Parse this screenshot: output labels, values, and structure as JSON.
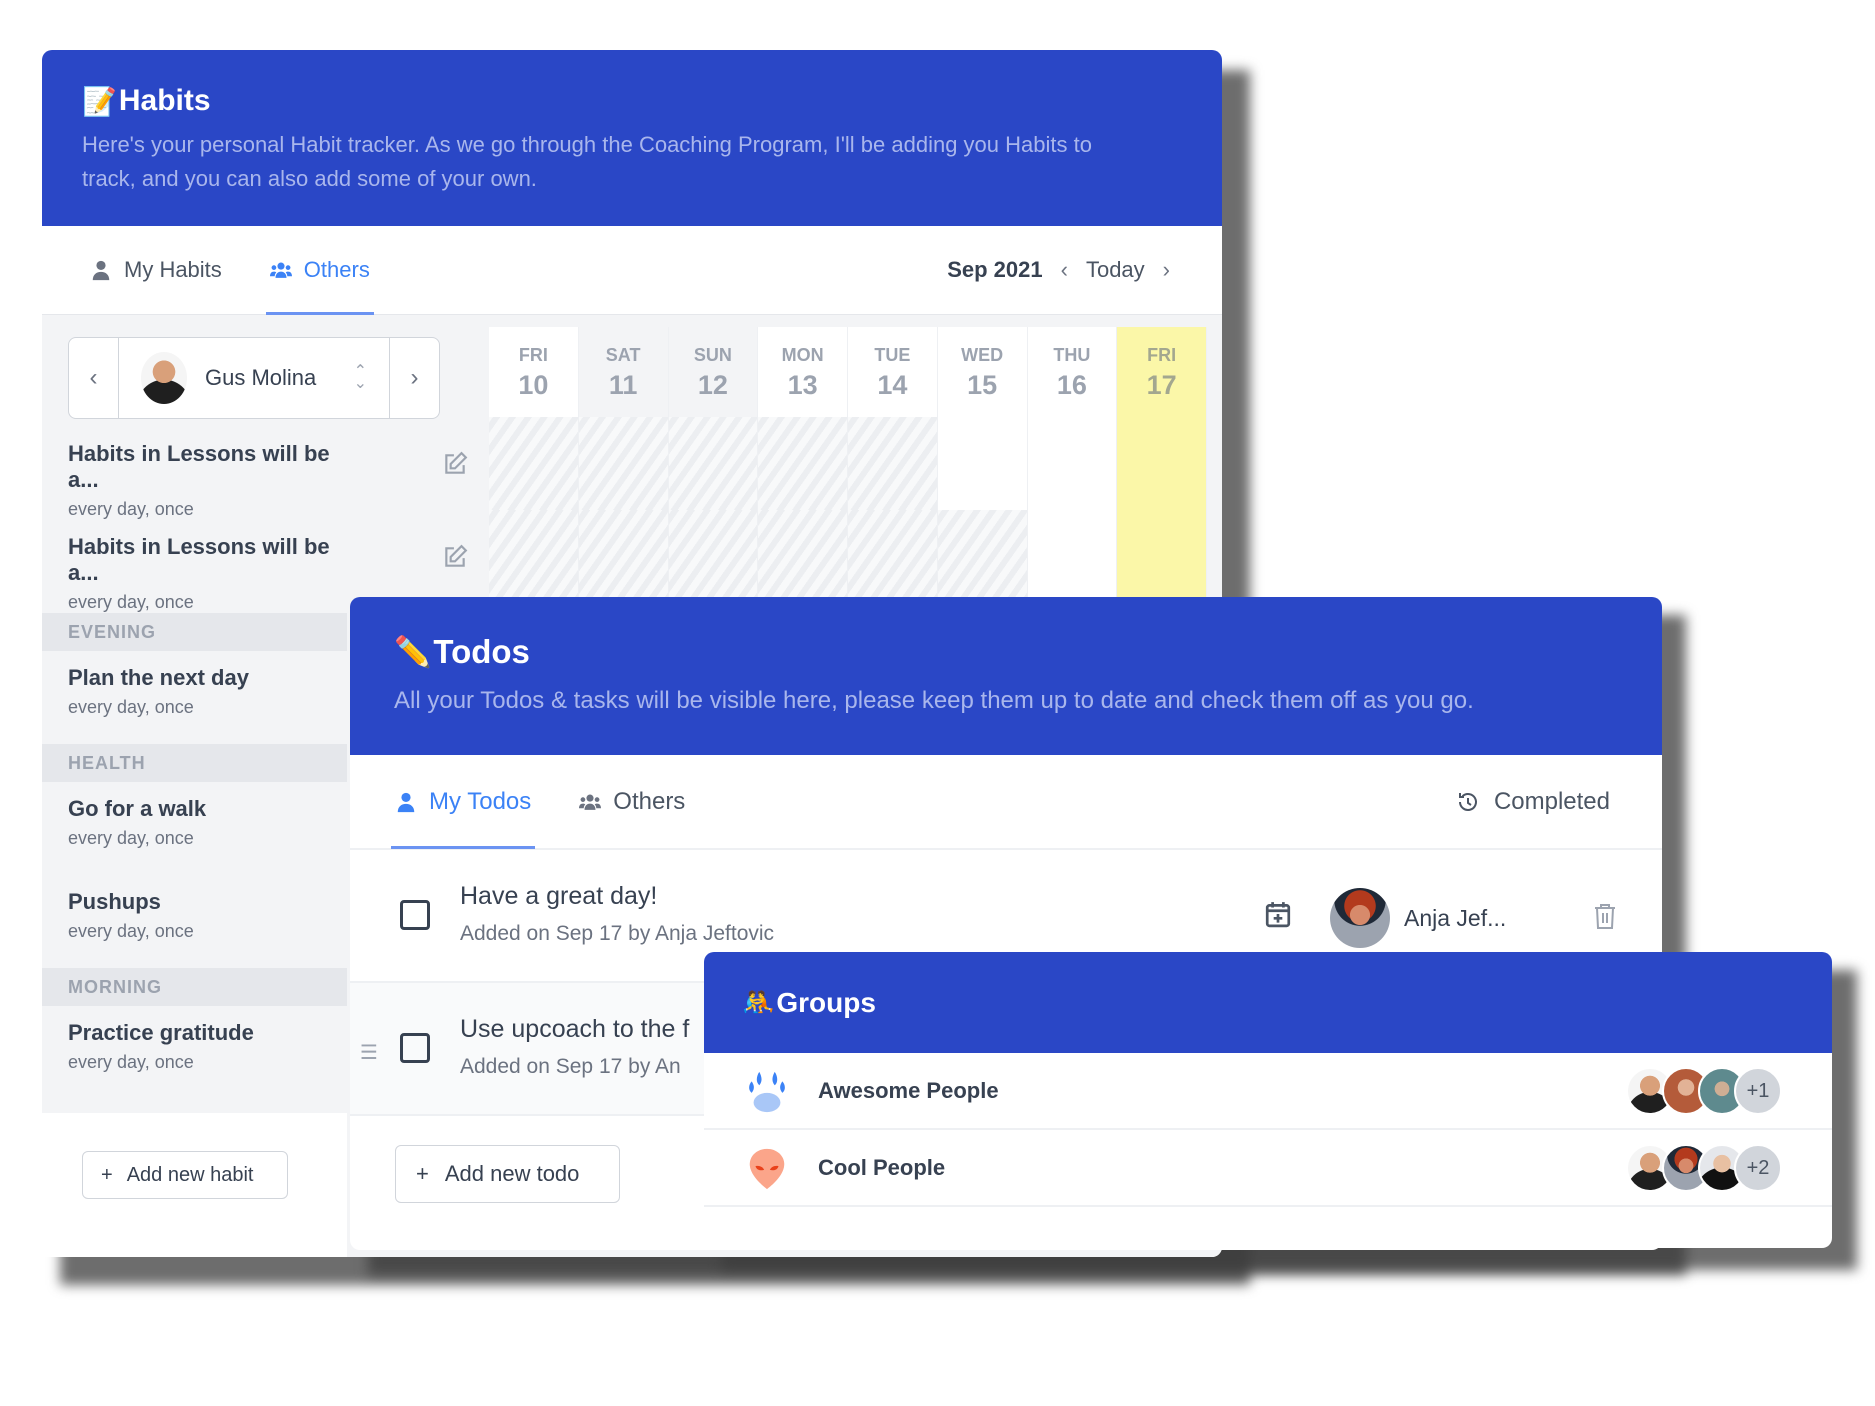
{
  "habits": {
    "title": "Habits",
    "title_icon": "memo-emoji",
    "subtitle_line1": "Here's your personal Habit tracker. As we go through the Coaching Program, I'll be adding you Habits to",
    "subtitle_line2": "track, and you can also add some of your own.",
    "tabs": [
      {
        "label": "My Habits",
        "icon": "user-icon",
        "active": false
      },
      {
        "label": "Others",
        "icon": "users-icon",
        "active": true
      }
    ],
    "month": "Sep 2021",
    "today_label": "Today",
    "selected_user": "Gus Molina",
    "days": [
      {
        "name": "FRI",
        "date": "10"
      },
      {
        "name": "SAT",
        "date": "11"
      },
      {
        "name": "SUN",
        "date": "12"
      },
      {
        "name": "MON",
        "date": "13"
      },
      {
        "name": "TUE",
        "date": "14"
      },
      {
        "name": "WED",
        "date": "15"
      },
      {
        "name": "THU",
        "date": "16"
      },
      {
        "name": "FRI",
        "date": "17"
      }
    ],
    "items": [
      {
        "name": "Habits in Lessons will be a...",
        "freq": "every day, once"
      },
      {
        "name": "Habits in Lessons will be a...",
        "freq": "every day, once"
      }
    ],
    "sections": [
      {
        "label": "EVENING",
        "items": [
          {
            "name": "Plan the next day",
            "freq": "every day, once"
          }
        ]
      },
      {
        "label": "HEALTH",
        "items": [
          {
            "name": "Go for a walk",
            "freq": "every day, once"
          },
          {
            "name": "Pushups",
            "freq": "every day, once"
          }
        ]
      },
      {
        "label": "MORNING",
        "items": [
          {
            "name": "Practice gratitude",
            "freq": "every day, once"
          }
        ]
      }
    ],
    "add_label": "Add new habit"
  },
  "todos": {
    "title": "Todos",
    "title_icon": "pencil-emoji",
    "subtitle": "All your Todos & tasks will be visible here, please keep them up to date and check them off as you go.",
    "tabs": [
      {
        "label": "My Todos",
        "icon": "user-icon",
        "active": true
      },
      {
        "label": "Others",
        "icon": "users-icon",
        "active": false
      }
    ],
    "completed_label": "Completed",
    "items": [
      {
        "title": "Have a great day!",
        "sub": "Added on Sep 17 by Anja Jeftovic",
        "assignee": "Anja Jef...",
        "checked": false
      },
      {
        "title": "Use upcoach to the f",
        "sub": "Added on Sep 17 by An",
        "checked": false
      }
    ],
    "add_label": "Add new todo"
  },
  "groups": {
    "title": "Groups",
    "title_icon": "people-wrestling-emoji",
    "items": [
      {
        "name": "Awesome People",
        "icon": "paw-icon",
        "extra": "+1"
      },
      {
        "name": "Cool People",
        "icon": "alien-icon",
        "extra": "+2"
      }
    ]
  },
  "colors": {
    "header_blue": "#2a47c6",
    "accent_blue": "#3b82f6",
    "today_highlight": "#fbf7a8"
  }
}
